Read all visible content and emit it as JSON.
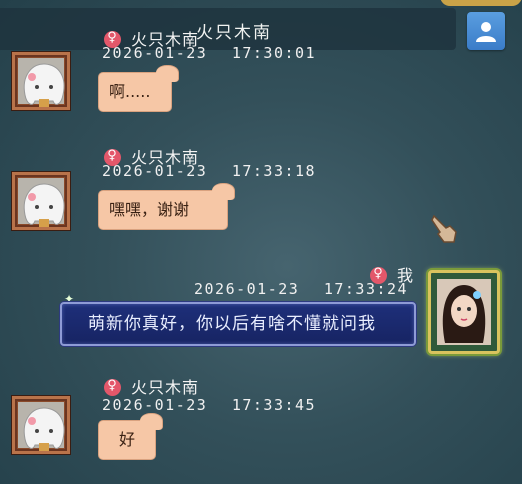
{
  "header": {
    "title": "火只木南"
  },
  "icons": {
    "top_right": "user-icon",
    "gender": "female-symbol-icon",
    "cursor": "hand-pointer-icon"
  },
  "messages": [
    {
      "sender": "火只木南",
      "date": "2026-01-23",
      "time": "17:30:01",
      "text": "啊....."
    },
    {
      "sender": "火只木南",
      "date": "2026-01-23",
      "time": "17:33:18",
      "text": "嘿嘿，谢谢"
    },
    {
      "sender": "我",
      "date": "2026-01-23",
      "time": "17:33:24",
      "text": "萌新你真好，你以后有啥不懂就问我"
    },
    {
      "sender": "火只木南",
      "date": "2026-01-23",
      "time": "17:33:45",
      "text": "好"
    }
  ],
  "colors": {
    "incoming_bubble": "#f6c7a6",
    "outgoing_bubble": "#1e2f7a",
    "female_badge": "#e3576a",
    "top_button": "#4a8ed8"
  }
}
